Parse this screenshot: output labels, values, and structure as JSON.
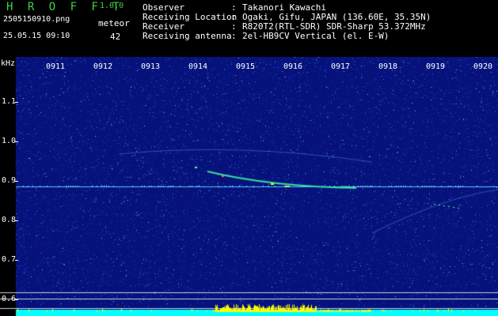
{
  "header": {
    "app_name": "H R O F F T",
    "version": "1.0.0",
    "file_name": "2505150910.png",
    "date_time": "25.05.15 09:10",
    "meteor_label": "meteor",
    "meteor_count": "42"
  },
  "station_info": [
    {
      "label": "Observer",
      "value": "Takanori Kawachi"
    },
    {
      "label": "Receiving Location",
      "value": "Ogaki, Gifu, JAPAN (136.60E, 35.35N)"
    },
    {
      "label": "Receiver",
      "value": "R820T2(RTL-SDR) SDR-Sharp 53.372MHz"
    },
    {
      "label": "Receiving antenna",
      "value": "2el-HB9CV Vertical (el. E-W)"
    }
  ],
  "axis": {
    "unit": "kHz",
    "freq_labels": [
      "1.1",
      "1.0",
      "0.9",
      "0.8",
      "0.7",
      "0.6"
    ],
    "hour_labels": [
      "0911",
      "0912",
      "0913",
      "0914",
      "0915",
      "0916",
      "0917",
      "0918",
      "0919",
      "0920"
    ]
  },
  "colors": {
    "title_green": "#3fd23f",
    "text": "#ffffff",
    "background_field": "#06127a",
    "carrier_line": "#58c8ff",
    "signal_cyan": "#00ffff",
    "signal_yellow": "#ffff00"
  }
}
